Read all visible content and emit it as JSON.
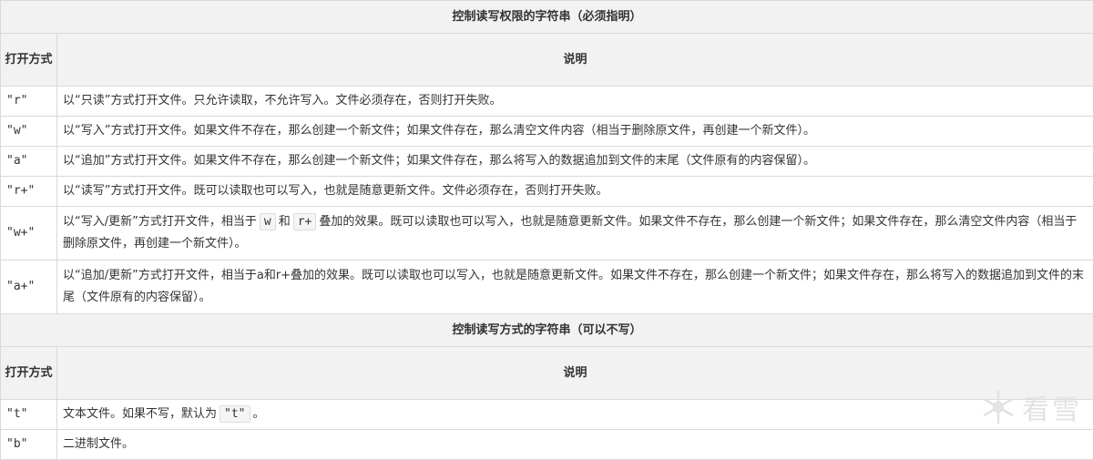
{
  "section1": {
    "title": "控制读写权限的字符串（必须指明）",
    "header": {
      "mode": "打开方式",
      "desc": "说明"
    },
    "rows": [
      {
        "mode": "\"r\"",
        "desc": "以“只读”方式打开文件。只允许读取，不允许写入。文件必须存在，否则打开失败。"
      },
      {
        "mode": "\"w\"",
        "desc": "以“写入”方式打开文件。如果文件不存在，那么创建一个新文件；如果文件存在，那么清空文件内容（相当于删除原文件，再创建一个新文件）。"
      },
      {
        "mode": "\"a\"",
        "desc": "以“追加”方式打开文件。如果文件不存在，那么创建一个新文件；如果文件存在，那么将写入的数据追加到文件的末尾（文件原有的内容保留）。"
      },
      {
        "mode": "\"r+\"",
        "desc": "以“读写”方式打开文件。既可以读取也可以写入，也就是随意更新文件。文件必须存在，否则打开失败。"
      },
      {
        "mode": "\"w+\"",
        "desc_pre": "以“写入/更新”方式打开文件，相当于",
        "code1": "w",
        "desc_mid": "和",
        "code2": "r+",
        "desc_post": "叠加的效果。既可以读取也可以写入，也就是随意更新文件。如果文件不存在，那么创建一个新文件；如果文件存在，那么清空文件内容（相当于删除原文件，再创建一个新文件）。"
      },
      {
        "mode": "\"a+\"",
        "desc": "以“追加/更新”方式打开文件，相当于a和r+叠加的效果。既可以读取也可以写入，也就是随意更新文件。如果文件不存在，那么创建一个新文件；如果文件存在，那么将写入的数据追加到文件的末尾（文件原有的内容保留）。"
      }
    ]
  },
  "section2": {
    "title": "控制读写方式的字符串（可以不写）",
    "header": {
      "mode": "打开方式",
      "desc": "说明"
    },
    "rows": [
      {
        "mode": "\"t\"",
        "desc_pre": "文本文件。如果不写，默认为",
        "code1": "\"t\"",
        "desc_post": "。"
      },
      {
        "mode": "\"b\"",
        "desc": "二进制文件。"
      }
    ]
  },
  "watermark": {
    "text": "看雪",
    "icon": "snowflake-icon"
  }
}
